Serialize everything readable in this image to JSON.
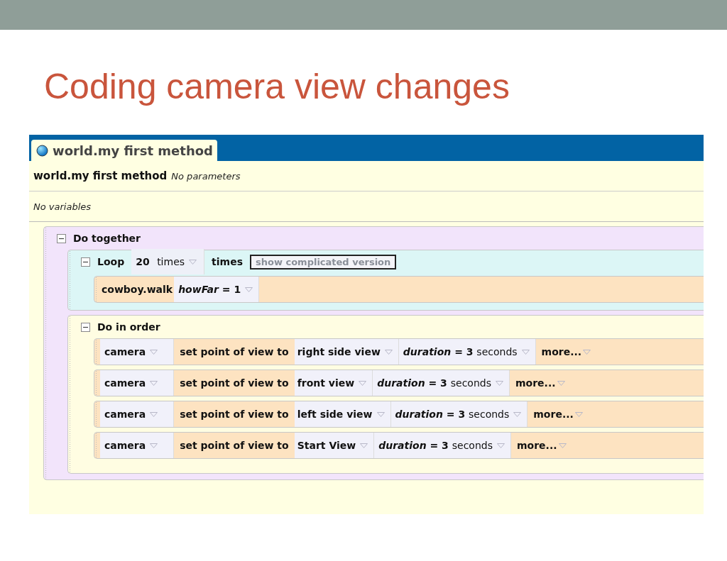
{
  "slide_title": "Coding camera view changes",
  "tab": {
    "label": "world.my first method"
  },
  "method": {
    "name": "world.my first method",
    "params": "No parameters"
  },
  "variables": "No variables",
  "do_together": {
    "label": "Do together",
    "loop": {
      "label": "Loop",
      "count": "20",
      "count_unit": "times",
      "times_label": "times",
      "button": "show complicated version",
      "statement": {
        "object": "cowboy.walk",
        "param_name": "howFar",
        "param_value": "= 1"
      }
    },
    "do_in_order": {
      "label": "Do in order",
      "statements": [
        {
          "object": "camera",
          "method": "set point of view to",
          "target": "right side view",
          "param_name": "duration",
          "param_value": "= 3",
          "param_unit": "seconds",
          "more": "more..."
        },
        {
          "object": "camera",
          "method": "set point of view to",
          "target": "front view",
          "param_name": "duration",
          "param_value": "= 3",
          "param_unit": "seconds",
          "more": "more..."
        },
        {
          "object": "camera",
          "method": "set point of view to",
          "target": "left side view",
          "param_name": "duration",
          "param_value": "= 3",
          "param_unit": "seconds",
          "more": "more..."
        },
        {
          "object": "camera",
          "method": "set point of view to",
          "target": "Start View",
          "param_name": "duration",
          "param_value": "= 3",
          "param_unit": "seconds",
          "more": "more..."
        }
      ]
    }
  }
}
